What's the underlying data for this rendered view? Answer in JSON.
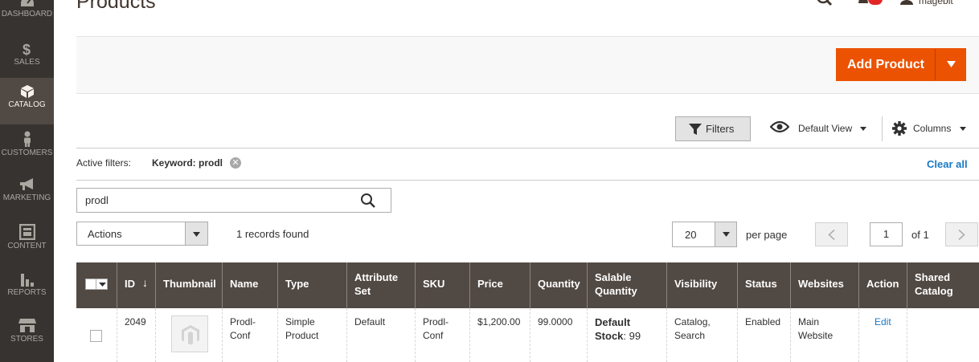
{
  "sidebar": {
    "items": [
      {
        "label": "DASHBOARD",
        "icon": "dashboard-icon"
      },
      {
        "label": "SALES",
        "icon": "dollar-icon"
      },
      {
        "label": "CATALOG",
        "icon": "box-icon",
        "active": true
      },
      {
        "label": "CUSTOMERS",
        "icon": "person-icon"
      },
      {
        "label": "MARKETING",
        "icon": "megaphone-icon"
      },
      {
        "label": "CONTENT",
        "icon": "layout-icon"
      },
      {
        "label": "REPORTS",
        "icon": "bar-chart-icon"
      },
      {
        "label": "STORES",
        "icon": "storefront-icon"
      }
    ]
  },
  "header": {
    "title": "Products",
    "user_name": "magebit"
  },
  "page_actions": {
    "add_product_label": "Add Product"
  },
  "toolbar": {
    "filters_label": "Filters",
    "view_label": "Default View",
    "columns_label": "Columns"
  },
  "active_filters": {
    "label": "Active filters:",
    "keyword": "Keyword: prodl",
    "clear_all": "Clear all"
  },
  "search": {
    "value": "prodl"
  },
  "mass_actions": {
    "label": "Actions"
  },
  "records_found": "1 records found",
  "pagination": {
    "per_page_value": "20",
    "per_page_label": "per page",
    "current_page": "1",
    "of_pages": "of 1"
  },
  "grid": {
    "columns": [
      "ID",
      "Thumbnail",
      "Name",
      "Type",
      "Attribute Set",
      "SKU",
      "Price",
      "Quantity",
      "Salable Quantity",
      "Visibility",
      "Status",
      "Websites",
      "Action",
      "Shared Catalog"
    ],
    "sort_arrow": "↓",
    "rows": [
      {
        "id": "2049",
        "name": "Prodl-Conf",
        "type": "Simple Product",
        "attribute_set": "Default",
        "sku": "Prodl-Conf",
        "price": "$1,200.00",
        "quantity": "99.0000",
        "salable_label": "Default Stock",
        "salable_value": ": 99",
        "visibility": "Catalog, Search",
        "status": "Enabled",
        "websites": "Main Website",
        "action": "Edit",
        "shared_catalog": ""
      }
    ]
  },
  "colors": {
    "sidebar_bg": "#373330",
    "sidebar_active": "#514943",
    "header_row": "#514943",
    "accent": "#eb5202",
    "link": "#1979c3"
  }
}
